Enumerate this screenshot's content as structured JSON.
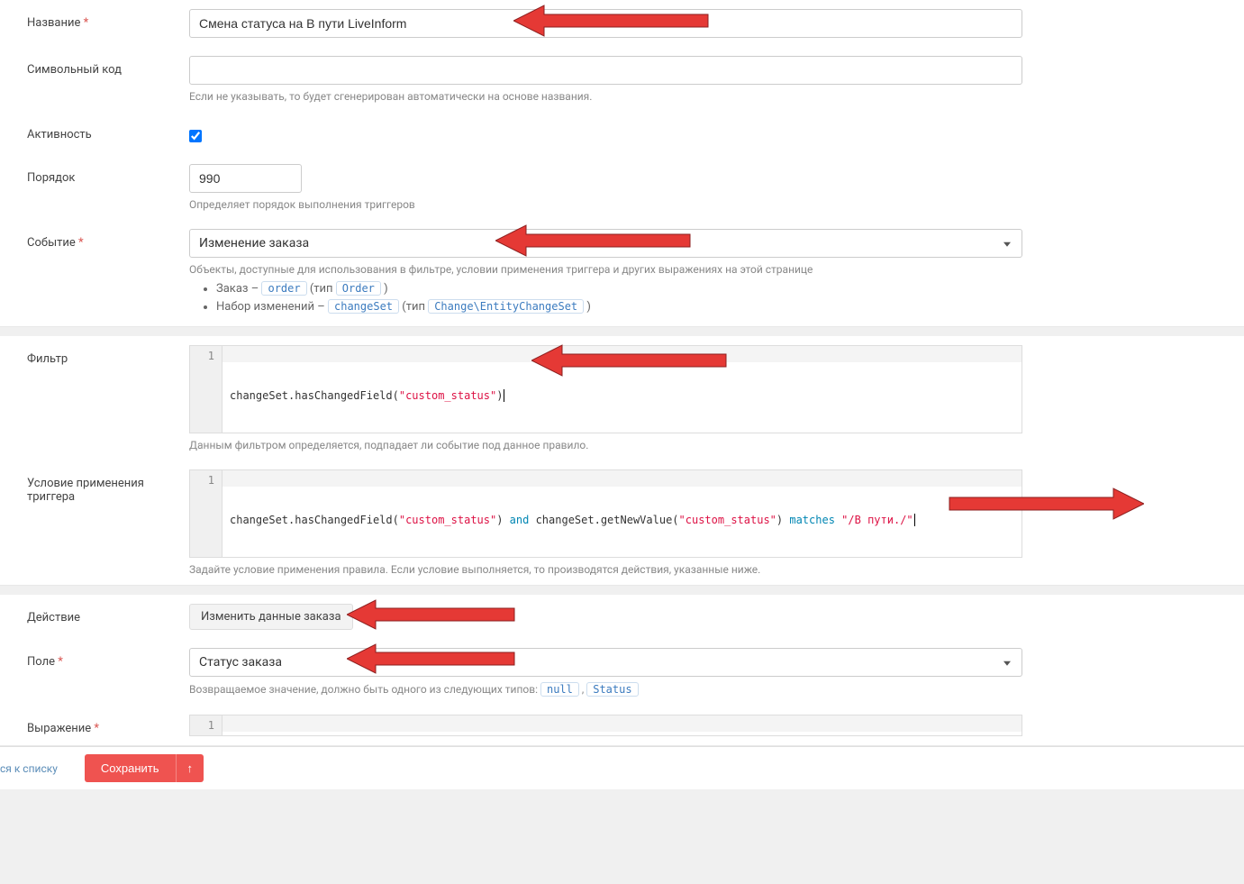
{
  "fields": {
    "name": {
      "label": "Название",
      "value": "Смена статуса на В пути LiveInform"
    },
    "code": {
      "label": "Символьный код",
      "value": "",
      "help": "Если не указывать, то будет сгенерирован автоматически на основе названия."
    },
    "active": {
      "label": "Активность",
      "checked": true
    },
    "order": {
      "label": "Порядок",
      "value": "990",
      "help": "Определяет порядок выполнения триггеров"
    },
    "event": {
      "label": "Событие",
      "value": "Изменение заказа",
      "help": "Объекты, доступные для использования в фильтре, условии применения триггера и других выражениях на этой странице",
      "objects": [
        {
          "prefix": "Заказ – ",
          "var": "order",
          "mid": " (тип ",
          "type": "Order",
          "suffix": " )"
        },
        {
          "prefix": "Набор изменений – ",
          "var": "changeSet",
          "mid": " (тип ",
          "type": "Change\\EntityChangeSet",
          "suffix": " )"
        }
      ]
    },
    "filter": {
      "label": "Фильтр",
      "help": "Данным фильтром определяется, подпадает ли событие под данное правило.",
      "code_tokens": [
        {
          "t": "changeSet.hasChangedField(",
          "c": "fn"
        },
        {
          "t": "\"custom_status\"",
          "c": "str"
        },
        {
          "t": ")",
          "c": "fn"
        }
      ]
    },
    "condition": {
      "label": "Условие применения триггера",
      "help": "Задайте условие применения правила. Если условие выполняется, то производятся действия, указанные ниже.",
      "code_tokens": [
        {
          "t": "changeSet.hasChangedField(",
          "c": "fn"
        },
        {
          "t": "\"custom_status\"",
          "c": "str"
        },
        {
          "t": ") ",
          "c": "fn"
        },
        {
          "t": "and",
          "c": "kw"
        },
        {
          "t": " changeSet.getNewValue(",
          "c": "fn"
        },
        {
          "t": "\"custom_status\"",
          "c": "str"
        },
        {
          "t": ") ",
          "c": "fn"
        },
        {
          "t": "matches",
          "c": "kw"
        },
        {
          "t": " ",
          "c": "fn"
        },
        {
          "t": "\"/В пути./\"",
          "c": "str"
        }
      ]
    },
    "action": {
      "label": "Действие",
      "value": "Изменить данные заказа"
    },
    "field": {
      "label": "Поле",
      "value": "Статус заказа",
      "help_prefix": "Возвращаемое значение, должно быть одного из следующих типов: ",
      "types": [
        "null",
        "Status"
      ]
    },
    "expression": {
      "label": "Выражение"
    }
  },
  "footer": {
    "back": "ся к списку",
    "save": "Сохранить",
    "arrow_icon": "↑"
  },
  "gutter_line": "1"
}
